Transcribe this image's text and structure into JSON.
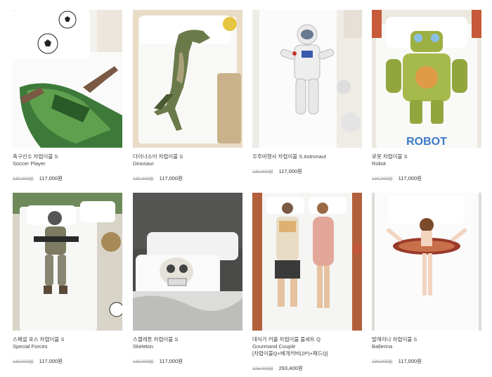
{
  "products": [
    {
      "title_ko": "축구선수 차렵이불 S",
      "title_en": "Soccer Player",
      "price_original": "130,000원",
      "price_sale": "117,000원"
    },
    {
      "title_ko": "다이너소어 차렵이불 S",
      "title_en": "Dinosaur",
      "price_original": "130,000원",
      "price_sale": "117,000원"
    },
    {
      "title_ko": "우주비행사 차렵이불 S Astronaut",
      "title_en": "",
      "price_original": "130,000원",
      "price_sale": "117,000원"
    },
    {
      "title_ko": "로봇 차렵이불 S",
      "title_en": "Robot",
      "price_original": "130,000원",
      "price_sale": "117,000원"
    },
    {
      "title_ko": "스페셜 포스 차렵이불 S",
      "title_en": "Special Forces",
      "price_original": "130,000원",
      "price_sale": "117,000원"
    },
    {
      "title_ko": "스켈레톤 차렵이불 S",
      "title_en": "Skeleton",
      "price_original": "130,000원",
      "price_sale": "117,000원"
    },
    {
      "title_ko": "대식가 커플 차렵이불 풀세트 Q",
      "title_en": "Gourmand Couple",
      "title_extra": "[차렵이불Q+베개커버(2P)+패드Q]",
      "price_original": "326,000원",
      "price_sale": "293,400원"
    },
    {
      "title_ko": "발레리나 차렵이불 S",
      "title_en": "Ballerina",
      "price_original": "130,000원",
      "price_sale": "117,000원"
    }
  ],
  "robot_text": "ROBOT"
}
